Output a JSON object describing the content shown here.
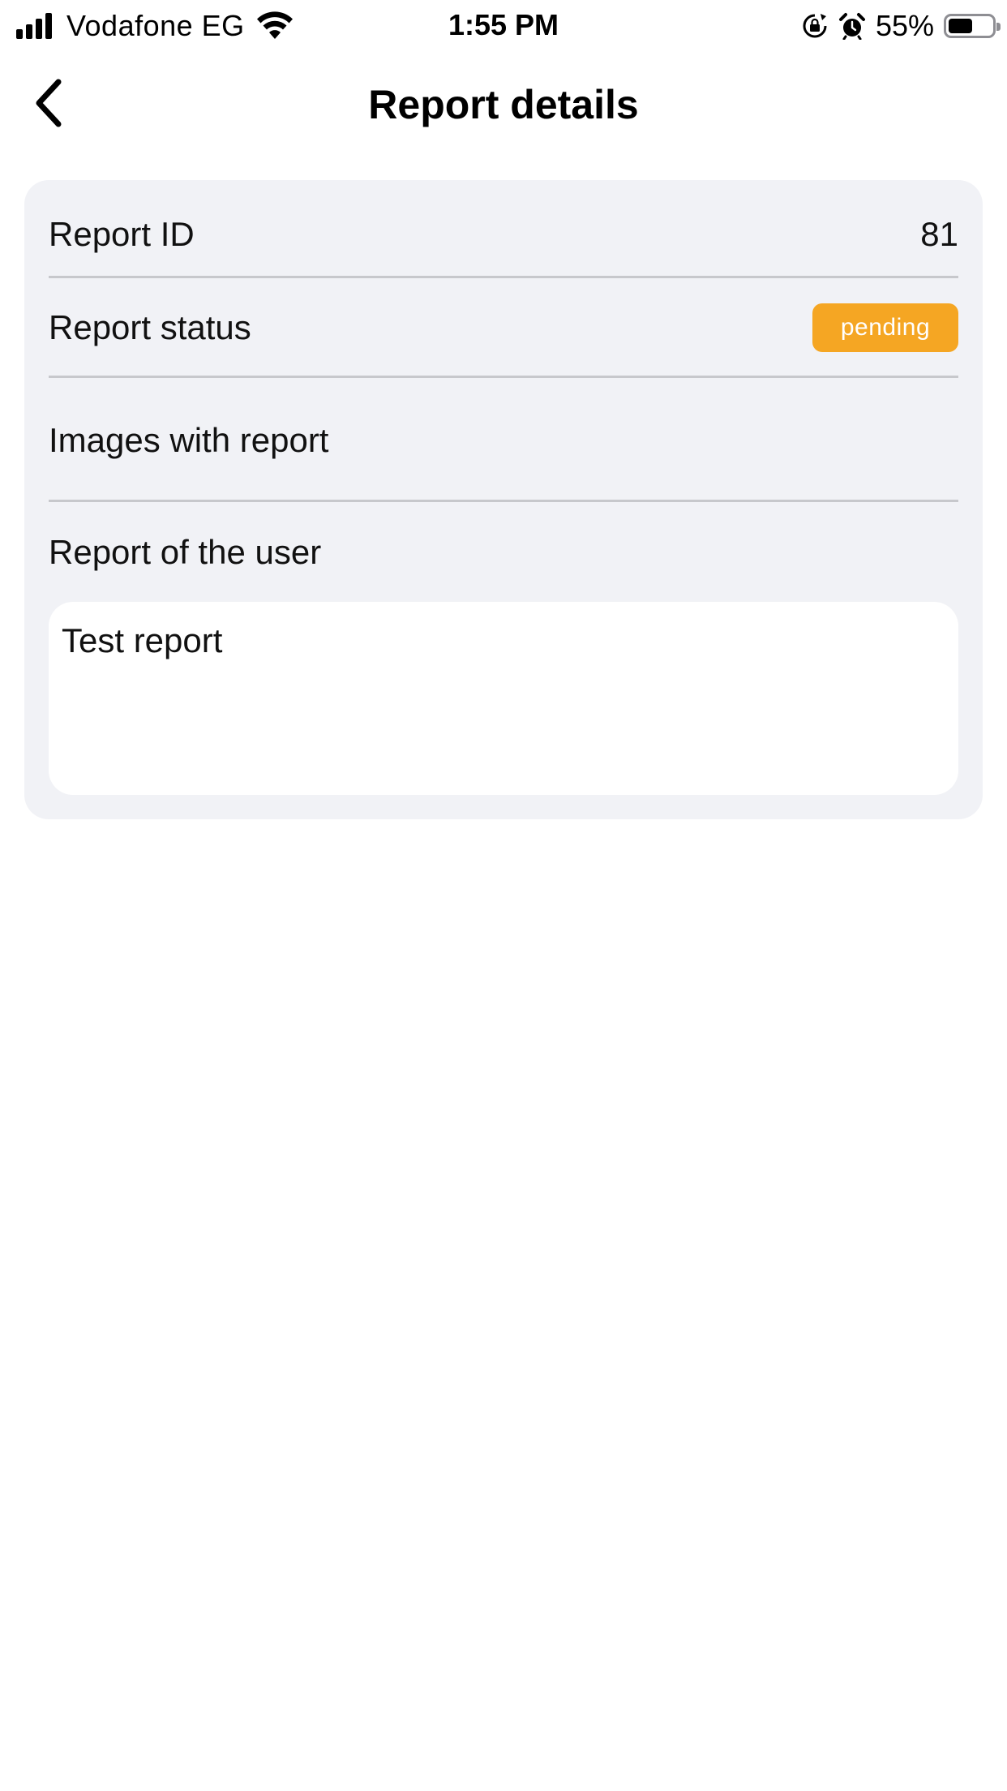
{
  "status_bar": {
    "carrier": "Vodafone EG",
    "time": "1:55 PM",
    "battery_percent": "55%",
    "battery_level": 0.55,
    "icons": [
      "signal-icon",
      "wifi-icon",
      "orientation-lock-icon",
      "alarm-icon",
      "battery-icon"
    ]
  },
  "nav": {
    "title": "Report details",
    "back_icon": "chevron-left-icon"
  },
  "details": {
    "report_id_label": "Report ID",
    "report_id_value": "81",
    "report_status_label": "Report status",
    "report_status_value": "pending",
    "status_color": "#f5a623",
    "images_label": "Images with report",
    "user_report_label": "Report of the user",
    "user_report_text": "Test report"
  }
}
